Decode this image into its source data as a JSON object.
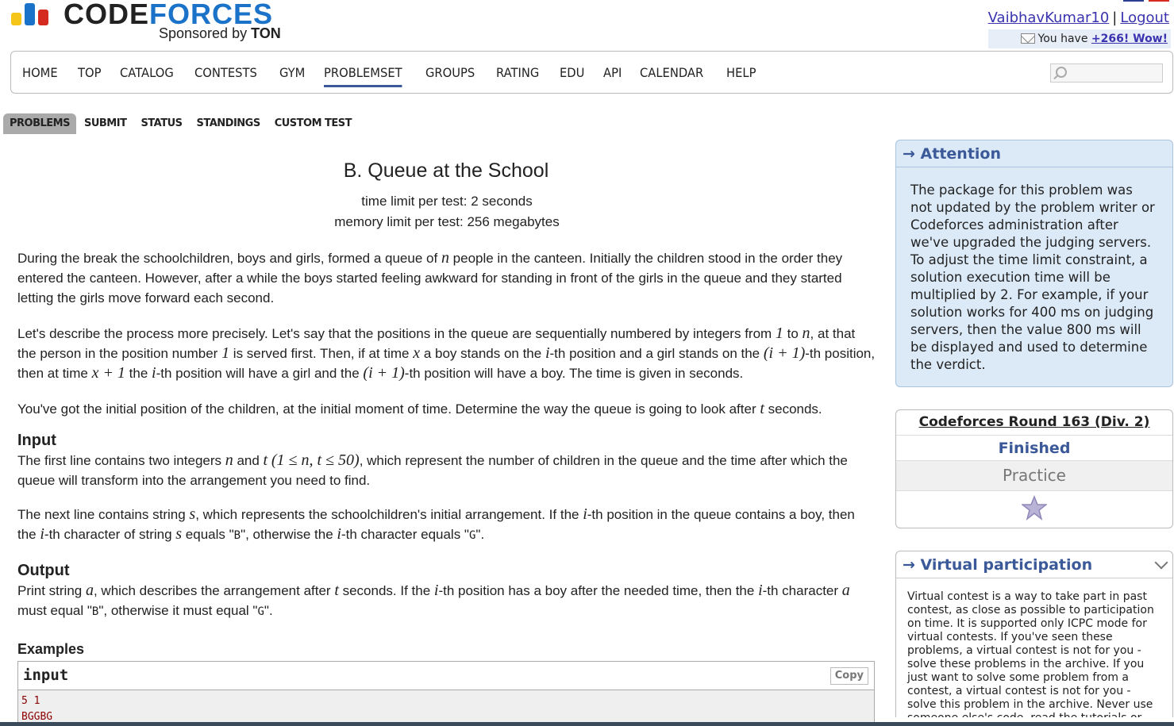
{
  "header": {
    "logo_word_1": "CODE",
    "logo_word_2": "FORCES",
    "sponsor_prefix": "Sponsored by ",
    "sponsor_name": "TON",
    "username": "VaibhavKumar10",
    "separator": "|",
    "logout": "Logout",
    "mail_prefix": "You have ",
    "mail_count": "+266! Wow!"
  },
  "nav": {
    "items": [
      "HOME",
      "TOP",
      "CATALOG",
      "CONTESTS",
      "GYM",
      "PROBLEMSET",
      "GROUPS",
      "RATING",
      "EDU",
      "API",
      "CALENDAR",
      "HELP"
    ],
    "active": "PROBLEMSET",
    "search_placeholder": ""
  },
  "subnav": {
    "items": [
      "PROBLEMS",
      "SUBMIT",
      "STATUS",
      "STANDINGS",
      "CUSTOM TEST"
    ],
    "active": "PROBLEMS"
  },
  "problem": {
    "title": "B. Queue at the School",
    "time_limit": "time limit per test: 2 seconds",
    "memory_limit": "memory limit per test: 256 megabytes",
    "legend_1a": "During the break the schoolchildren, boys and girls, formed a queue of ",
    "legend_1b": " people in the canteen. Initially the children stood in the order they entered the canteen. However, after a while the boys started feeling awkward for standing in front of the girls in the queue and they started letting the girls move forward each second.",
    "legend_2a": "Let's describe the process more precisely. Let's say that the positions in the queue are sequentially numbered by integers from ",
    "legend_2b": " to ",
    "legend_2c": ", at that the person in the position number ",
    "legend_2d": " is served first. Then, if at time ",
    "legend_2e": " a boy stands on the ",
    "legend_2f": "-th position and a girl stands on the ",
    "legend_2g": "-th position, then at time ",
    "legend_2h": " the ",
    "legend_2i": "-th position will have a girl and the ",
    "legend_2j": "-th position will have a boy. The time is given in seconds.",
    "legend_3a": "You've got the initial position of the children, at the initial moment of time. Determine the way the queue is going to look after ",
    "legend_3b": " seconds.",
    "input_title": "Input",
    "input_1a": "The first line contains two integers ",
    "input_1b": " and ",
    "input_1c": ", which represent the number of children in the queue and the time after which the queue will transform into the arrangement you need to find.",
    "input_2a": "The next line contains string ",
    "input_2b": ", which represents the schoolchildren's initial arrangement. If the ",
    "input_2c": "-th position in the queue contains a boy, then the ",
    "input_2d": "-th character of string ",
    "input_2e": " equals \"",
    "input_2f": "\", otherwise the ",
    "input_2g": "-th character equals \"",
    "input_2h": "\".",
    "output_title": "Output",
    "output_a": "Print string ",
    "output_b": ", which describes the arrangement after ",
    "output_c": " seconds. If the ",
    "output_d": "-th position has a boy after the needed time, then the ",
    "output_e": "-th character ",
    "output_f": " must equal \"",
    "output_g": "\", otherwise it must equal \"",
    "output_h": "\".",
    "examples_title": "Examples",
    "example_input_label": "input",
    "copy_label": "Copy",
    "example_line_1": "5 1",
    "example_line_2": "BGGBG"
  },
  "math": {
    "n": "n",
    "one": "1",
    "x": "x",
    "i": "i",
    "i_plus_1": "(i + 1)",
    "x_plus_1": "x + 1",
    "t": "t",
    "range": "(1 ≤ n, t ≤ 50)",
    "s": "s",
    "B": "B",
    "G": "G",
    "a": "a"
  },
  "sidebar": {
    "attention_title": "→ Attention",
    "attention_text": "The package for this problem was not updated by the problem writer or Codeforces administration after we've upgraded the judging servers. To adjust the time limit constraint, a solution execution time will be multiplied by 2. For example, if your solution works for 400 ms on judging servers, then the value 800 ms will be displayed and used to determine the verdict.",
    "round_name": "Codeforces Round 163 (Div. 2)",
    "round_status": "Finished",
    "round_practice": "Practice",
    "virtual_title": "→ Virtual participation",
    "virtual_text": "Virtual contest is a way to take part in past contest, as close as possible to participation on time. It is supported only ICPC mode for virtual contests. If you've seen these problems, a virtual contest is not for you - solve these problems in the archive. If you just want to solve some problem from a contest, a virtual contest is not for you - solve this problem in the archive. Never use someone else's code, read the tutorials or"
  },
  "colors": {
    "brand_blue": "#1a73c9",
    "link": "#3a33b0",
    "box_title": "#3b5998",
    "logo_yellow": "#f5c518",
    "logo_blue": "#1a73c9",
    "logo_red": "#d42a20"
  }
}
